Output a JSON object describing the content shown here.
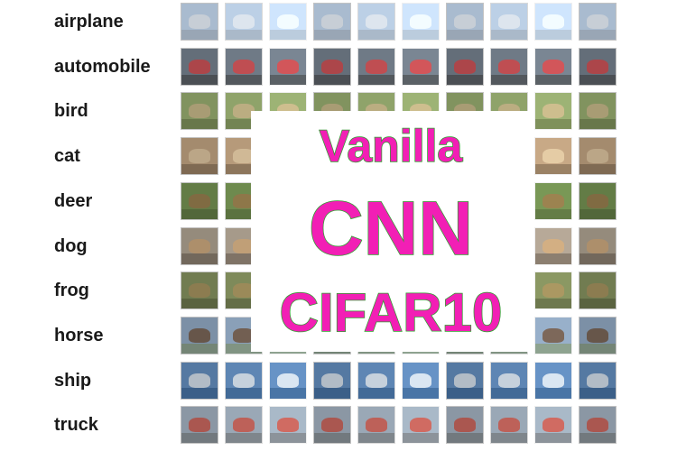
{
  "classes": [
    "airplane",
    "automobile",
    "bird",
    "cat",
    "deer",
    "dog",
    "frog",
    "horse",
    "ship",
    "truck"
  ],
  "overlay": {
    "line1": "Vanilla",
    "line2": "CNN",
    "line3": "CIFAR10",
    "text_color": "#f21fb5",
    "outline_color": "#2fa12f"
  },
  "tiles_per_row": 10,
  "tile_palettes": [
    {
      "bg": "#bcd0e6",
      "fg": "#e8ecf0",
      "ground": "#9aa5b0"
    },
    {
      "bg": "#6f7a86",
      "fg": "#d94040",
      "ground": "#3c3c3c"
    },
    {
      "bg": "#8fa36a",
      "fg": "#c9b08a",
      "ground": "#5d6b3f"
    },
    {
      "bg": "#b69a7a",
      "fg": "#d8c3a0",
      "ground": "#6c5a44"
    },
    {
      "bg": "#6e8a4e",
      "fg": "#9a7048",
      "ground": "#4c5e34"
    },
    {
      "bg": "#a69a8a",
      "fg": "#c8a070",
      "ground": "#5e5448"
    },
    {
      "bg": "#7e8a5a",
      "fg": "#a58a5a",
      "ground": "#4e5838"
    },
    {
      "bg": "#8aa0b8",
      "fg": "#6a4a30",
      "ground": "#7a8a58"
    },
    {
      "bg": "#5e86b4",
      "fg": "#eaeaea",
      "ground": "#2c5480"
    },
    {
      "bg": "#9aa8b6",
      "fg": "#c84a3a",
      "ground": "#6a6a6a"
    }
  ]
}
